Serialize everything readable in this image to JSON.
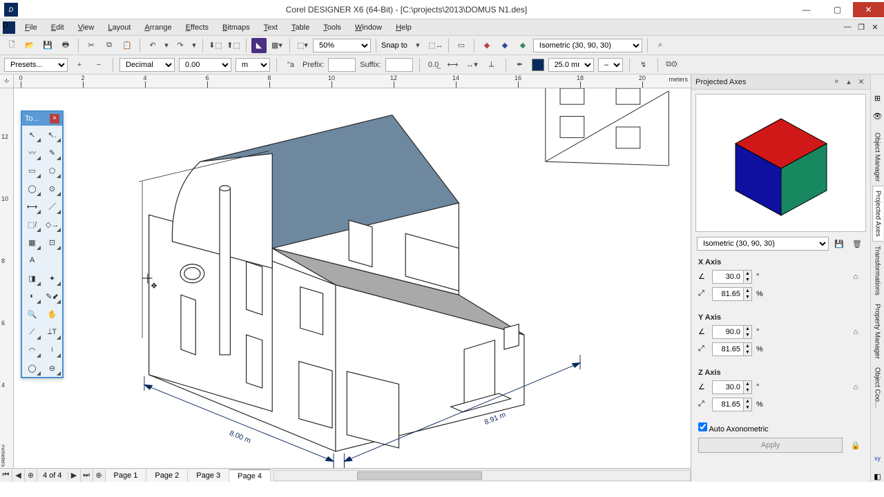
{
  "app": {
    "title": "Corel DESIGNER X6 (64-Bit) - [C:\\projects\\2013\\DOMUS N1.des]",
    "icon_label": "D"
  },
  "menus": [
    "File",
    "Edit",
    "View",
    "Layout",
    "Arrange",
    "Effects",
    "Bitmaps",
    "Text",
    "Table",
    "Tools",
    "Window",
    "Help"
  ],
  "toolbar": {
    "zoom_value": "50%",
    "snap_label": "Snap to",
    "projection_value": "Isometric (30, 90, 30)"
  },
  "propbar": {
    "presets": "Presets...",
    "style": "Decimal",
    "value": "0.00",
    "unit": "m",
    "prefix_label": "Prefix:",
    "prefix_value": "",
    "suffix_label": "Suffix:",
    "suffix_value": "",
    "outline_width": "25.0 mm"
  },
  "toolbox_title": "To...",
  "ruler": {
    "h_majors": [
      0,
      2,
      4,
      6,
      8,
      10,
      12,
      14,
      16,
      18,
      20
    ],
    "v_majors": [
      2,
      4,
      6,
      8,
      10,
      12
    ],
    "unit": "meters"
  },
  "dim_left": "8.00 m",
  "dim_right": "8.91 m",
  "docker": {
    "title": "Projected Axes",
    "projection_value": "Isometric (30, 90, 30)",
    "xaxis_label": "X Axis",
    "yaxis_label": "Y Axis",
    "zaxis_label": "Z Axis",
    "x_angle": "30.0",
    "x_scale": "81.65",
    "y_angle": "90.0",
    "y_scale": "81.65",
    "z_angle": "30.0",
    "z_scale": "81.65",
    "auto_label": "Auto Axonometric",
    "apply_label": "Apply",
    "deg": "°",
    "pct": "%"
  },
  "sidetabs": [
    "Object Manager",
    "Projected Axes",
    "Transformations",
    "Property Manager",
    "Object Coo..."
  ],
  "pagebar": {
    "counter": "4 of 4",
    "tabs": [
      "Page 1",
      "Page 2",
      "Page 3",
      "Page 4"
    ],
    "active_index": 3
  }
}
